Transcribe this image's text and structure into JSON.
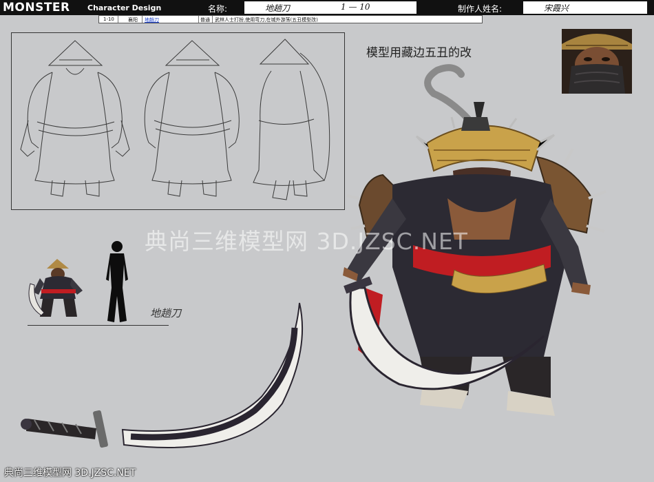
{
  "header": {
    "brand": "MONSTER",
    "brand_sub": "Character Design",
    "name_label": "名称:",
    "name_value": "地趟刀",
    "range_value": "1 — 10",
    "author_label": "制作人姓名:",
    "author_value": "宋霞兴"
  },
  "info_row": {
    "level": "1-10",
    "region": "襄阳",
    "name_link": "地趟刀",
    "grade": "普通",
    "description": "武林人士打扮,使用弯刀,在城外游荡(五丑模型改)"
  },
  "note": "模型用藏边五丑的改",
  "silhouette_signature": "地趟刀",
  "watermark": "典尚三维模型网 3D.JZSC.NET",
  "watermark_footer": "典尚三维模型网 3D.JZSC.NET",
  "colors": {
    "background": "#c8c9cb",
    "header_bar": "#111111",
    "robe": "#2c2a33",
    "sash_red": "#c01d22",
    "straw": "#c9a24a",
    "blade": "#efeeea",
    "blade_edge": "#2a2530",
    "skin": "#8a5a3a"
  }
}
